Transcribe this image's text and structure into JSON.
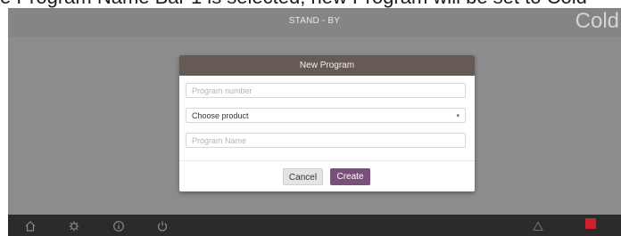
{
  "caption": {
    "text": "e Program Name Bar 1 is selected, new Program will be set to Cold"
  },
  "header": {
    "status": "STAND - BY",
    "right_label": "Cold"
  },
  "dialog": {
    "title": "New Program",
    "program_number_placeholder": "Program number",
    "product_select": "Choose product",
    "program_name_placeholder": "Program Name",
    "cancel_label": "Cancel",
    "create_label": "Create"
  },
  "colors": {
    "dialog_header": "#665a56",
    "create_button": "#7a4f7a",
    "alarm_red": "#d0202a",
    "bottom_bar": "#2b2b2b"
  },
  "bottom_bar": {
    "icons": [
      "home-icon",
      "settings-icon",
      "info-icon",
      "power-icon",
      "warning-icon",
      "alarm-indicator"
    ]
  }
}
